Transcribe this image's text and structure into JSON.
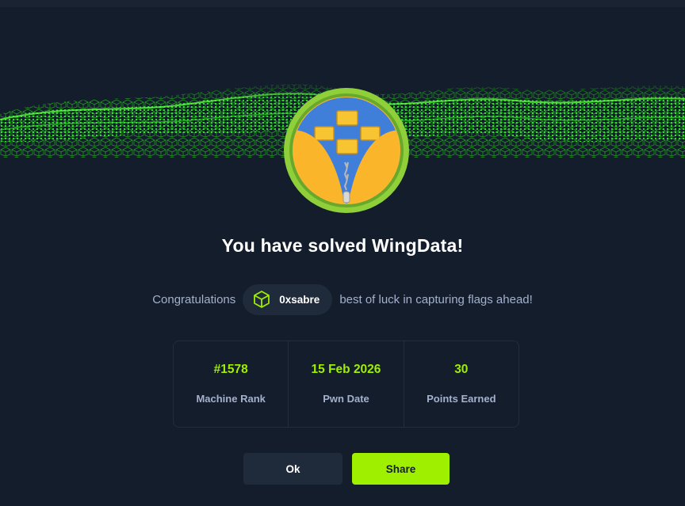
{
  "modal": {
    "title": "You have solved WingData!",
    "congrats_prefix": "Congratulations",
    "congrats_suffix": "best of luck in capturing flags ahead!",
    "user": {
      "name": "0xsabre",
      "icon": "cube-icon"
    },
    "avatar_icon": "zipped-folders-icon",
    "stats": [
      {
        "value": "#1578",
        "label": "Machine Rank"
      },
      {
        "value": "15 Feb 2026",
        "label": "Pwn Date"
      },
      {
        "value": "30",
        "label": "Points Earned"
      }
    ],
    "buttons": {
      "ok": "Ok",
      "share": "Share"
    }
  },
  "colors": {
    "background": "#141d2b",
    "accent": "#9fef00",
    "muted_text": "#a4b1cd",
    "chip_bg": "#1f2a3a"
  }
}
